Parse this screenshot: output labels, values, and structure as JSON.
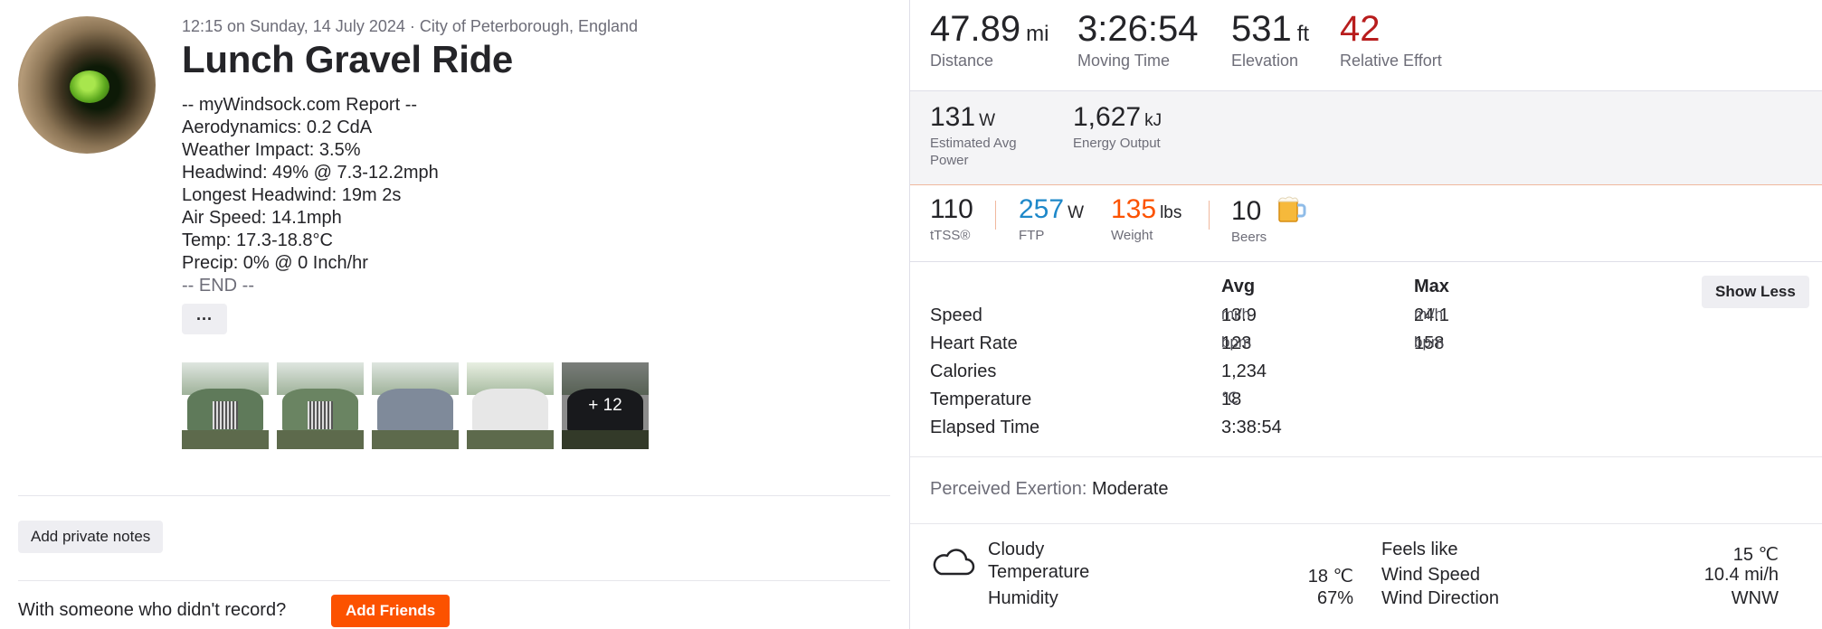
{
  "activity": {
    "meta": "12:15 on Sunday, 14 July 2024 · City of Peterborough, England",
    "title": "Lunch Gravel Ride",
    "report_lines": [
      "-- myWindsock.com Report --",
      "Aerodynamics: 0.2 CdA",
      "Weather Impact: 3.5%",
      "Headwind: 49% @ 7.3-12.2mph",
      "Longest Headwind: 19m 2s",
      "Air Speed: 14.1mph",
      "Temp: 17.3-18.8°C",
      "Precip: 0% @ 0 Inch/hr",
      "-- END --"
    ],
    "more_label": "···",
    "photos_more": "+ 12",
    "private_notes_label": "Add private notes",
    "with_someone_text": "With someone who didn't record?",
    "add_friends_label": "Add Friends"
  },
  "summary": {
    "distance": {
      "value": "47.89",
      "unit": "mi",
      "label": "Distance"
    },
    "moving_time": {
      "value": "3:26:54",
      "label": "Moving Time"
    },
    "elevation": {
      "value": "531",
      "unit": "ft",
      "label": "Elevation"
    },
    "relative_effort": {
      "value": "42",
      "label": "Relative Effort"
    }
  },
  "power": {
    "avg_power": {
      "value": "131",
      "unit": "W",
      "label": "Estimated Avg Power"
    },
    "energy": {
      "value": "1,627",
      "unit": "kJ",
      "label": "Energy Output"
    }
  },
  "pills": {
    "tss": {
      "value": "110",
      "label": "tTSS®"
    },
    "ftp": {
      "value": "257",
      "unit": "W",
      "label": "FTP"
    },
    "weight": {
      "value": "135",
      "unit": "lbs",
      "label": "Weight"
    },
    "beers": {
      "value": "10",
      "label": "Beers"
    }
  },
  "stats_table": {
    "col_avg": "Avg",
    "col_max": "Max",
    "show_less_label": "Show Less",
    "rows": [
      {
        "label": "Speed",
        "avg": "13.9",
        "avg_unit": "mi/h",
        "max": "24.1",
        "max_unit": "mi/h"
      },
      {
        "label": "Heart Rate",
        "avg": "123",
        "avg_unit": "bpm",
        "max": "158",
        "max_unit": "bpm"
      },
      {
        "label": "Calories",
        "avg": "1,234",
        "avg_unit": "",
        "max": "",
        "max_unit": ""
      },
      {
        "label": "Temperature",
        "avg": "18",
        "avg_unit": "℃",
        "max": "",
        "max_unit": ""
      },
      {
        "label": "Elapsed Time",
        "avg": "3:38:54",
        "avg_unit": "",
        "max": "",
        "max_unit": ""
      }
    ]
  },
  "perceived_exertion": {
    "label": "Perceived Exertion:",
    "value": "Moderate"
  },
  "weather": {
    "condition": "Cloudy",
    "temperature_label": "Temperature",
    "temperature": "18 ℃",
    "humidity_label": "Humidity",
    "humidity": "67%",
    "feels_like_label": "Feels like",
    "feels_like": "15 ℃",
    "wind_speed_label": "Wind Speed",
    "wind_speed": "10.4 mi/h",
    "wind_direction_label": "Wind Direction",
    "wind_direction": "WNW"
  },
  "colors": {
    "accent": "#fc5200",
    "relative_effort": "#b81d1d",
    "ftp": "#1e88c9",
    "weight": "#fc5200"
  },
  "icons": [
    "cloud-icon",
    "beer-icon",
    "more-icon"
  ]
}
